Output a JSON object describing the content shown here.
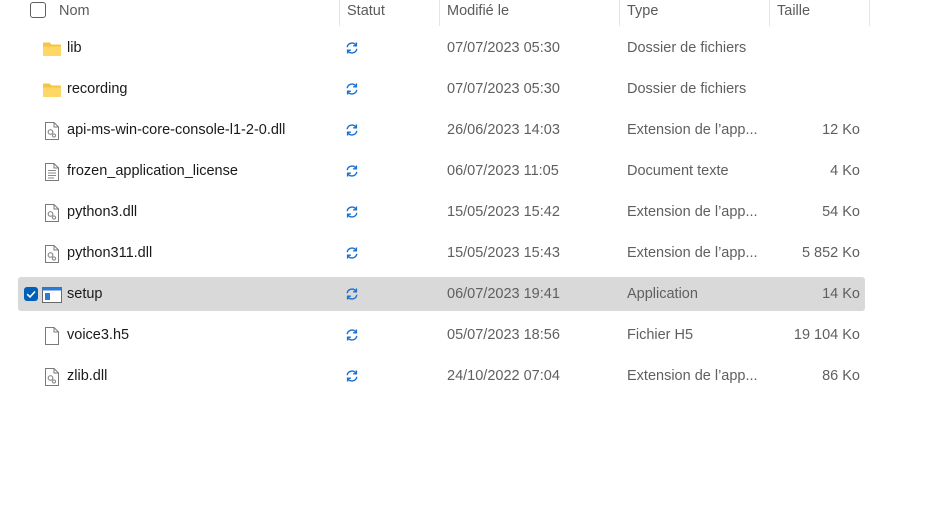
{
  "header": {
    "name": "Nom",
    "status": "Statut",
    "modified": "Modifié le",
    "type": "Type",
    "size": "Taille"
  },
  "colors": {
    "accent": "#005fb8",
    "folder": "#f4c542",
    "sync": "#1a6fd1",
    "selected_row": "#d9d9d9"
  },
  "files": [
    {
      "name": "lib",
      "icon": "folder-icon",
      "date": "07/07/2023 05:30",
      "type": "Dossier de fichiers",
      "size": "",
      "selected": false
    },
    {
      "name": "recording",
      "icon": "folder-icon",
      "date": "07/07/2023 05:30",
      "type": "Dossier de fichiers",
      "size": "",
      "selected": false
    },
    {
      "name": "api-ms-win-core-console-l1-2-0.dll",
      "icon": "dll-file-icon",
      "date": "26/06/2023 14:03",
      "type": "Extension de l’app...",
      "size": "12 Ko",
      "selected": false
    },
    {
      "name": "frozen_application_license",
      "icon": "text-file-icon",
      "date": "06/07/2023 11:05",
      "type": "Document texte",
      "size": "4 Ko",
      "selected": false
    },
    {
      "name": "python3.dll",
      "icon": "dll-file-icon",
      "date": "15/05/2023 15:42",
      "type": "Extension de l’app...",
      "size": "54 Ko",
      "selected": false
    },
    {
      "name": "python311.dll",
      "icon": "dll-file-icon",
      "date": "15/05/2023 15:43",
      "type": "Extension de l’app...",
      "size": "5 852 Ko",
      "selected": false
    },
    {
      "name": "setup",
      "icon": "application-icon",
      "date": "06/07/2023 19:41",
      "type": "Application",
      "size": "14 Ko",
      "selected": true
    },
    {
      "name": "voice3.h5",
      "icon": "blank-file-icon",
      "date": "05/07/2023 18:56",
      "type": "Fichier H5",
      "size": "19 104 Ko",
      "selected": false
    },
    {
      "name": "zlib.dll",
      "icon": "dll-file-icon",
      "date": "24/10/2022 07:04",
      "type": "Extension de l’app...",
      "size": "86 Ko",
      "selected": false
    }
  ]
}
